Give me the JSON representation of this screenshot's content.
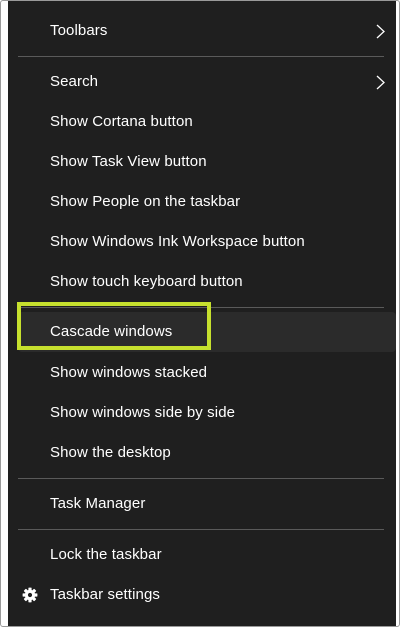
{
  "menu": {
    "toolbars": "Toolbars",
    "search": "Search",
    "show_cortana": "Show Cortana button",
    "show_task_view": "Show Task View button",
    "show_people": "Show People on the taskbar",
    "show_ink_workspace": "Show Windows Ink Workspace button",
    "show_touch_keyboard": "Show touch keyboard button",
    "cascade_windows": "Cascade windows",
    "show_stacked": "Show windows stacked",
    "show_side_by_side": "Show windows side by side",
    "show_desktop": "Show the desktop",
    "task_manager": "Task Manager",
    "lock_taskbar": "Lock the taskbar",
    "taskbar_settings": "Taskbar settings"
  },
  "icons": {
    "submenu_arrow": "chevron-right-icon",
    "settings": "gear-icon"
  },
  "colors": {
    "menu_background": "#1f1f1f",
    "hover_background": "#2b2b2b",
    "text": "#ffffff",
    "separator": "#5a5a5a",
    "highlight_border": "#c6e02e"
  }
}
